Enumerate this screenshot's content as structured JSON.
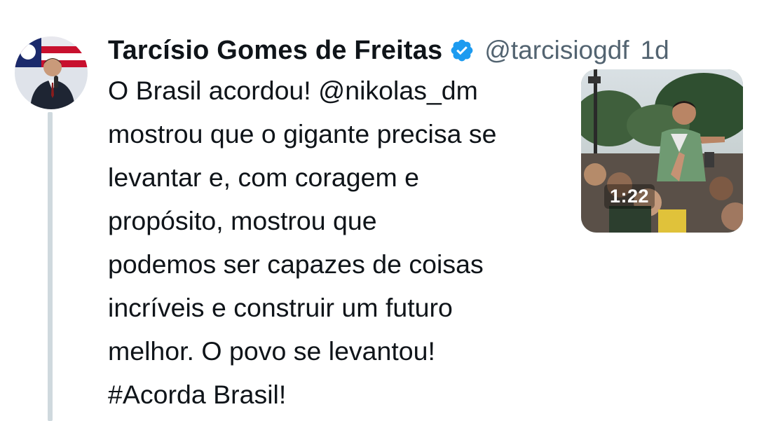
{
  "tweet": {
    "author_name": "Tarcísio Gomes de Freitas",
    "handle": "@tarcisiogdf",
    "time": "1d",
    "verified_icon": "verified-badge-icon",
    "colors": {
      "verified": "#1d9bf0",
      "secondary_text": "#536471",
      "thread_line": "#cfd9de"
    },
    "body": {
      "line1_before": "O Brasil acordou! ",
      "mention": "@nikolas_dm",
      "line2": "mostrou que o gigante precisa se",
      "line3": "levantar e, com coragem e",
      "line4": "propósito, mostrou que",
      "line5": "podemos ser capazes de coisas",
      "line6": "incríveis e construir um futuro",
      "line7": "melhor. O povo se levantou!",
      "hashtag": "#Acorda Brasil!"
    },
    "media": {
      "duration": "1:22"
    }
  }
}
